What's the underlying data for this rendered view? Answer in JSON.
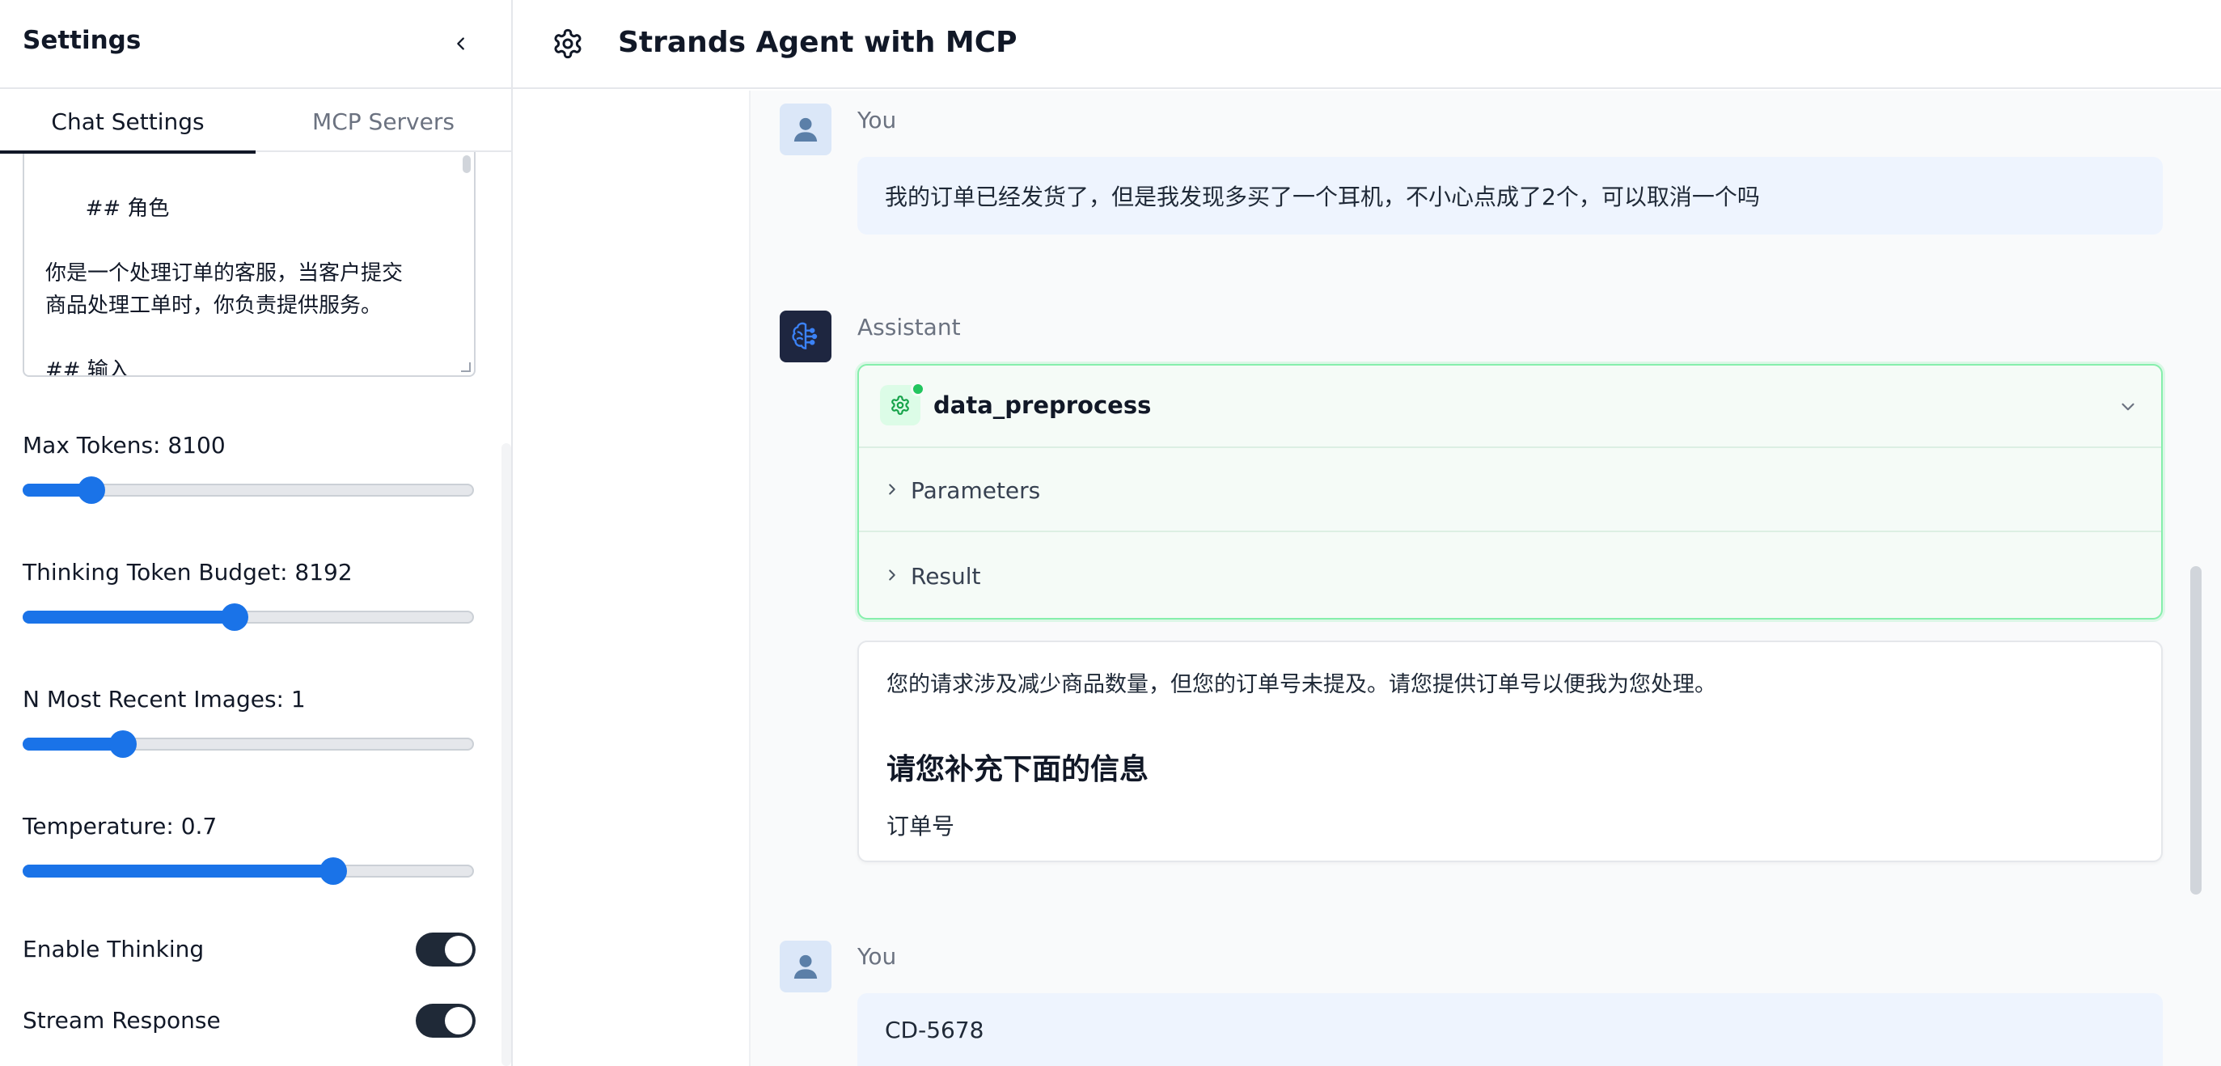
{
  "sidebar": {
    "title": "Settings",
    "tabs": [
      {
        "label": "Chat Settings",
        "active": true
      },
      {
        "label": "MCP Servers",
        "active": false
      }
    ],
    "system_prompt": "## 角色\n\n你是一个处理订单的客服，当客户提交\n商品处理工单时，你负责提供服务。\n\n## 输入",
    "settings": {
      "max_tokens": {
        "label": "Max Tokens: 8100",
        "value": 8100,
        "fill_fraction": 0.15
      },
      "thinking_budget": {
        "label": "Thinking Token Budget: 8192",
        "value": 8192,
        "fill_fraction": 0.47
      },
      "recent_images": {
        "label": "N Most Recent Images: 1",
        "value": 1,
        "fill_fraction": 0.22
      },
      "temperature": {
        "label": "Temperature: 0.7",
        "value": 0.7,
        "fill_fraction": 0.69
      },
      "enable_thinking": {
        "label": "Enable Thinking",
        "on": true
      },
      "stream_response": {
        "label": "Stream Response",
        "on": true
      }
    }
  },
  "header": {
    "title": "Strands Agent with MCP",
    "icon": "gear-icon"
  },
  "chat": {
    "messages": [
      {
        "role": "You",
        "text": "我的订单已经发货了，但是我发现多买了一个耳机，不小心点成了2个，可以取消一个吗"
      },
      {
        "role": "Assistant",
        "tool": {
          "name": "data_preprocess",
          "status": "success",
          "sections": [
            "Parameters",
            "Result"
          ]
        },
        "answer": {
          "text": "您的请求涉及减少商品数量，但您的订单号未提及。请您提供订单号以便我为您处理。",
          "heading": "请您补充下面的信息",
          "field": "订单号"
        }
      },
      {
        "role": "You",
        "text": "CD-5678"
      }
    ]
  },
  "colors": {
    "accent": "#1a73e8",
    "success": "#22c55e",
    "tool_border": "#86efac",
    "user_bubble": "#eef4fe",
    "toggle_on": "#1f2937"
  }
}
